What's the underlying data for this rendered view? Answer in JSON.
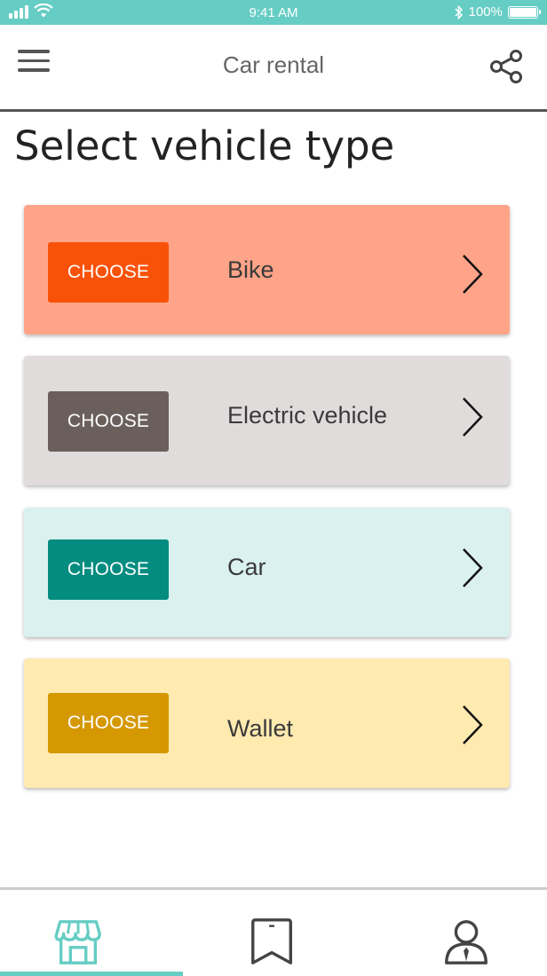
{
  "status_bar": {
    "time": "9:41 AM",
    "battery": "100%"
  },
  "header": {
    "title": "Car rental",
    "menu_icon": "hamburger-menu-icon",
    "share_icon": "share-icon"
  },
  "page": {
    "title": "Select vehicle type"
  },
  "vehicles": [
    {
      "label": "Bike",
      "button": "CHOOSE",
      "card_color": "#ffa488",
      "button_color": "#f85208"
    },
    {
      "label": "Electric vehicle",
      "button": "CHOOSE",
      "card_color": "#e0dcdc",
      "button_color": "#6a5f5b"
    },
    {
      "label": "Car",
      "button": "CHOOSE",
      "card_color": "#dbf1ef",
      "button_color": "#048c80"
    },
    {
      "label": "Wallet",
      "button": "CHOOSE",
      "card_color": "#ffeab0",
      "button_color": "#d59800"
    }
  ],
  "bottom_nav": {
    "items": [
      "store-icon",
      "bookmark-icon",
      "profile-icon"
    ],
    "active_color": "#66cdc4"
  }
}
